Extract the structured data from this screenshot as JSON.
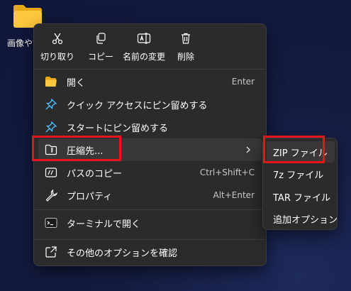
{
  "desktop": {
    "folder_label": "画像や証"
  },
  "quick_actions": [
    {
      "label": "切り取り",
      "icon": "scissors-icon"
    },
    {
      "label": "コピー",
      "icon": "copy-icon"
    },
    {
      "label": "名前の変更",
      "icon": "rename-icon"
    },
    {
      "label": "削除",
      "icon": "trash-icon"
    }
  ],
  "menu": {
    "items": [
      {
        "label": "開く",
        "shortcut": "Enter",
        "icon": "folder-open-icon"
      },
      {
        "label": "クイック アクセスにピン留めする",
        "shortcut": "",
        "icon": "pin-icon"
      },
      {
        "label": "スタートにピン留めする",
        "shortcut": "",
        "icon": "pin-icon"
      },
      {
        "label": "圧縮先...",
        "shortcut": "",
        "icon": "zip-folder-icon",
        "has_submenu": true
      },
      {
        "label": "パスのコピー",
        "shortcut": "Ctrl+Shift+C",
        "icon": "path-icon"
      },
      {
        "label": "プロパティ",
        "shortcut": "Alt+Enter",
        "icon": "wrench-icon"
      },
      {
        "label": "ターミナルで開く",
        "shortcut": "",
        "icon": "terminal-icon"
      },
      {
        "label": "その他のオプションを確認",
        "shortcut": "",
        "icon": "external-icon"
      }
    ]
  },
  "submenu": {
    "items": [
      {
        "label": "ZIP ファイル"
      },
      {
        "label": "7z ファイル"
      },
      {
        "label": "TAR ファイル"
      },
      {
        "label": "追加オプション"
      }
    ]
  },
  "colors": {
    "menu_bg": "#2b2b2b",
    "hover_bg": "#383838",
    "highlight": "#e8141c",
    "accent": "#4cc2ff"
  }
}
